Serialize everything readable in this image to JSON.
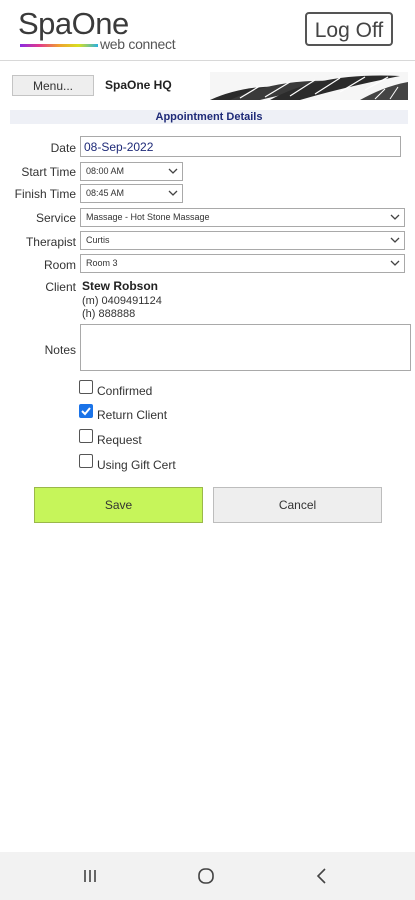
{
  "header": {
    "logo_main": "SpaOne",
    "logo_sub": "web connect",
    "logoff_label": "Log Off"
  },
  "topbar": {
    "menu_label": "Menu...",
    "location": "SpaOne HQ"
  },
  "section_title": "Appointment Details",
  "form": {
    "date_label": "Date",
    "date_value": "08-Sep-2022",
    "start_label": "Start Time",
    "start_value": "08:00 AM",
    "finish_label": "Finish Time",
    "finish_value": "08:45 AM",
    "service_label": "Service",
    "service_value": "Massage - Hot Stone Massage",
    "therapist_label": "Therapist",
    "therapist_value": "Curtis",
    "room_label": "Room",
    "room_value": "Room 3",
    "client_label": "Client",
    "client_name": "Stew Robson",
    "client_mobile": "(m) 0409491124",
    "client_home": "(h) 888888",
    "notes_label": "Notes",
    "notes_value": ""
  },
  "checkboxes": [
    {
      "label": "Confirmed",
      "checked": false
    },
    {
      "label": "Return Client",
      "checked": true
    },
    {
      "label": "Request",
      "checked": false
    },
    {
      "label": "Using Gift Cert",
      "checked": false
    }
  ],
  "buttons": {
    "save_label": "Save",
    "cancel_label": "Cancel"
  },
  "colors": {
    "save_bg": "#c6f55a",
    "section_text": "#1e2a78",
    "checkbox_checked": "#1a73e8"
  },
  "icons": {
    "chevron": "chevron-down-icon",
    "checkmark": "checkmark-icon",
    "nav_recent": "recent-apps-icon",
    "nav_home": "home-icon",
    "nav_back": "back-icon"
  }
}
